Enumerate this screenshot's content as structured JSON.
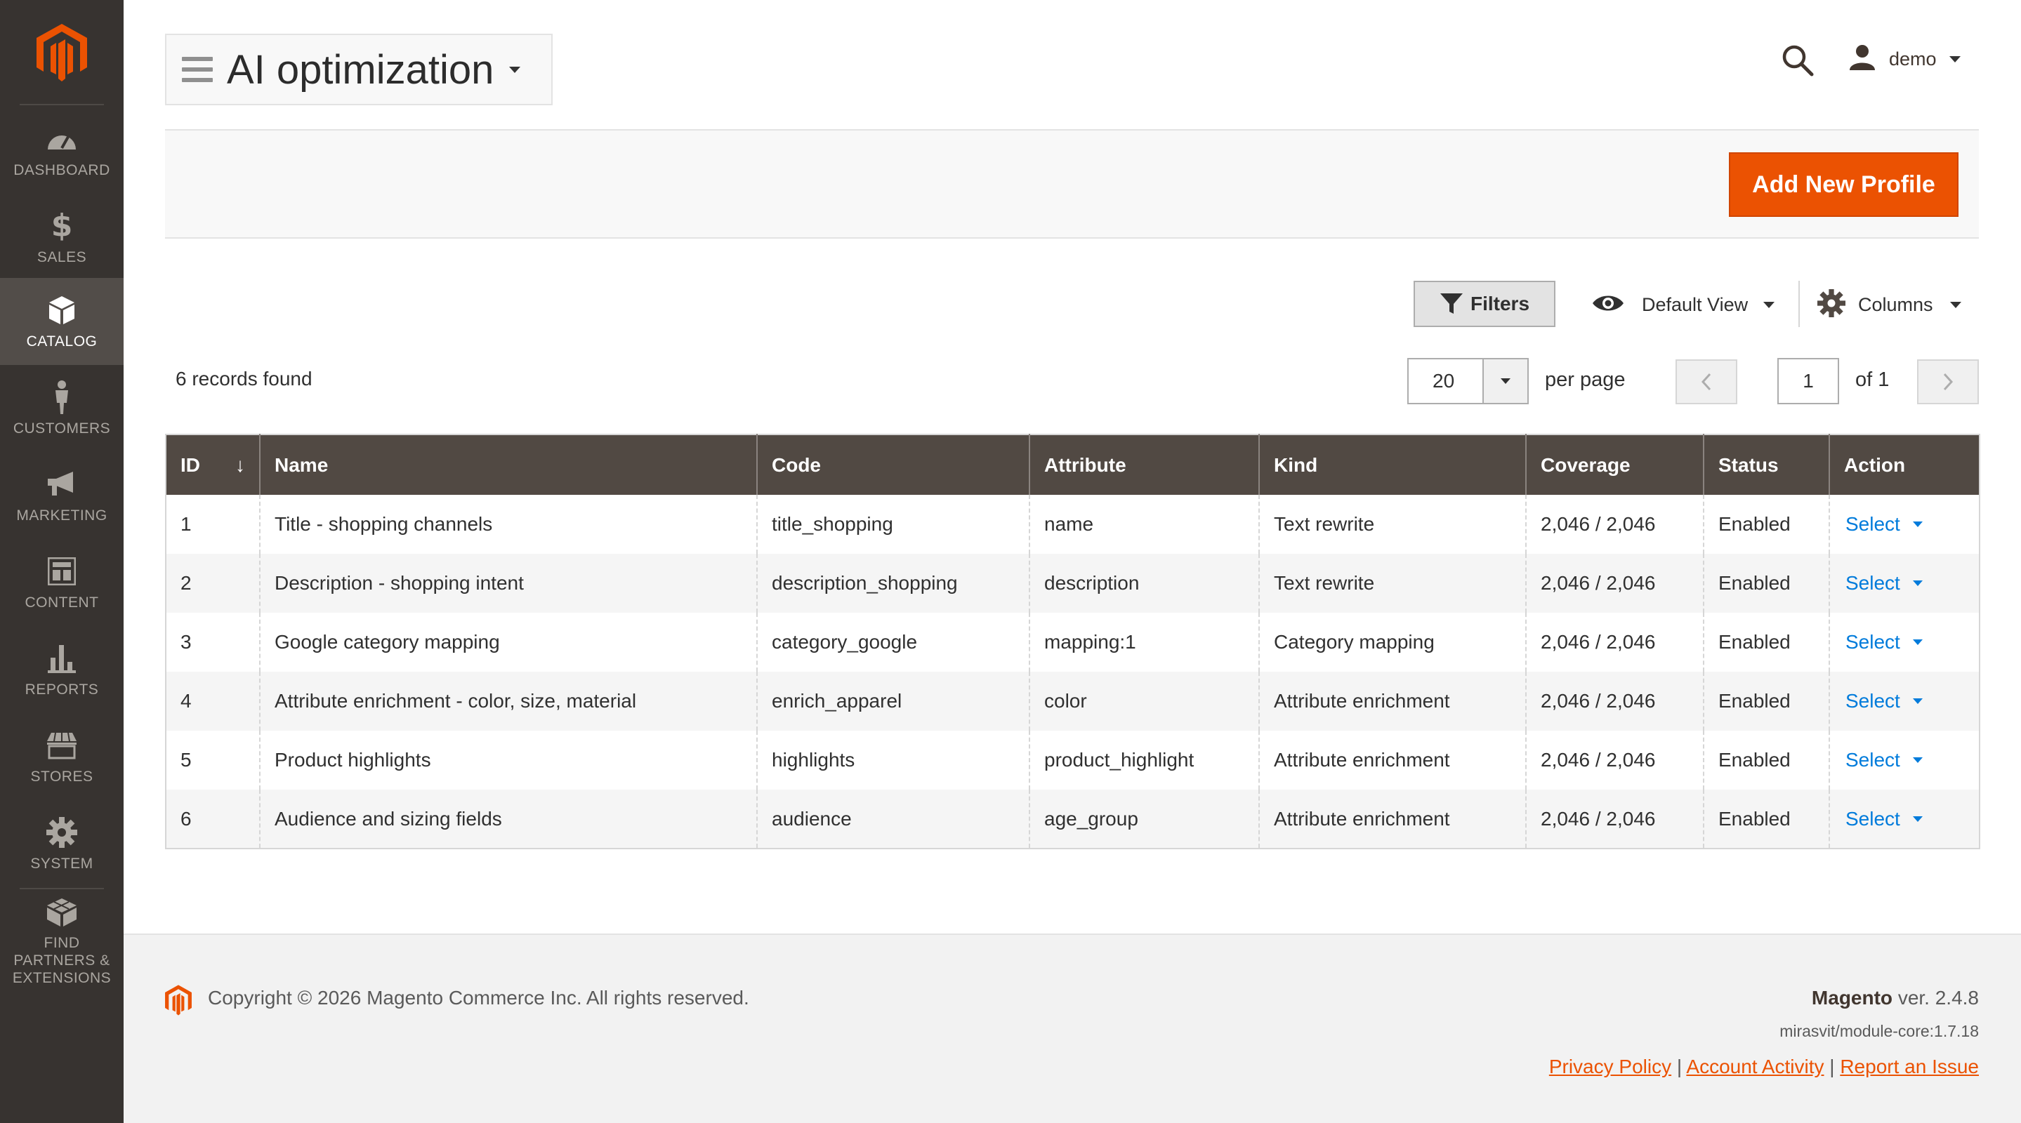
{
  "colors": {
    "sidebar_bg": "#373330",
    "sidebar_active_bg": "#524d49",
    "brand_orange": "#eb5202",
    "table_header_bg": "#514943",
    "link_blue": "#007bdb"
  },
  "sidebar": {
    "logo": "magento-logo-icon",
    "items": [
      {
        "label": "DASHBOARD",
        "icon": "speedometer-icon",
        "active": false
      },
      {
        "label": "SALES",
        "icon": "dollar-icon",
        "active": false
      },
      {
        "label": "CATALOG",
        "icon": "box-icon",
        "active": true
      },
      {
        "label": "CUSTOMERS",
        "icon": "person-icon",
        "active": false
      },
      {
        "label": "MARKETING",
        "icon": "megaphone-icon",
        "active": false
      },
      {
        "label": "CONTENT",
        "icon": "layout-icon",
        "active": false
      },
      {
        "label": "REPORTS",
        "icon": "bar-chart-icon",
        "active": false
      },
      {
        "label": "STORES",
        "icon": "storefront-icon",
        "active": false
      },
      {
        "label": "SYSTEM",
        "icon": "gear-icon",
        "active": false
      },
      {
        "label": "FIND PARTNERS & EXTENSIONS",
        "icon": "cubes-icon",
        "active": false
      }
    ]
  },
  "header": {
    "title": "AI optimization",
    "user_name": "demo"
  },
  "actions": {
    "add_button": "Add New Profile"
  },
  "grid_controls": {
    "filters_label": "Filters",
    "view_label": "Default View",
    "columns_label": "Columns",
    "records_found": "6 records found",
    "per_page_value": "20",
    "per_page_label": "per page",
    "current_page": "1",
    "page_total": "of 1"
  },
  "table": {
    "columns": [
      "ID",
      "Name",
      "Code",
      "Attribute",
      "Kind",
      "Coverage",
      "Status",
      "Action"
    ],
    "sort_indicator": "↓",
    "rows": [
      {
        "id": "1",
        "name": "Title - shopping channels",
        "code": "title_shopping",
        "attribute": "name",
        "kind": "Text rewrite",
        "coverage": "2,046 / 2,046",
        "status": "Enabled",
        "action": "Select"
      },
      {
        "id": "2",
        "name": "Description - shopping intent",
        "code": "description_shopping",
        "attribute": "description",
        "kind": "Text rewrite",
        "coverage": "2,046 / 2,046",
        "status": "Enabled",
        "action": "Select"
      },
      {
        "id": "3",
        "name": "Google category mapping",
        "code": "category_google",
        "attribute": "mapping:1",
        "kind": "Category mapping",
        "coverage": "2,046 / 2,046",
        "status": "Enabled",
        "action": "Select"
      },
      {
        "id": "4",
        "name": "Attribute enrichment - color, size, material",
        "code": "enrich_apparel",
        "attribute": "color",
        "kind": "Attribute enrichment",
        "coverage": "2,046 / 2,046",
        "status": "Enabled",
        "action": "Select"
      },
      {
        "id": "5",
        "name": "Product highlights",
        "code": "highlights",
        "attribute": "product_highlight",
        "kind": "Attribute enrichment",
        "coverage": "2,046 / 2,046",
        "status": "Enabled",
        "action": "Select"
      },
      {
        "id": "6",
        "name": "Audience and sizing fields",
        "code": "audience",
        "attribute": "age_group",
        "kind": "Attribute enrichment",
        "coverage": "2,046 / 2,046",
        "status": "Enabled",
        "action": "Select"
      }
    ]
  },
  "footer": {
    "copyright": "Copyright © 2026 Magento Commerce Inc. All rights reserved.",
    "brand": "Magento",
    "version": "ver. 2.4.8",
    "module_version": "mirasvit/module-core:1.7.18",
    "links": [
      "Privacy Policy",
      "Account Activity",
      "Report an Issue"
    ]
  }
}
